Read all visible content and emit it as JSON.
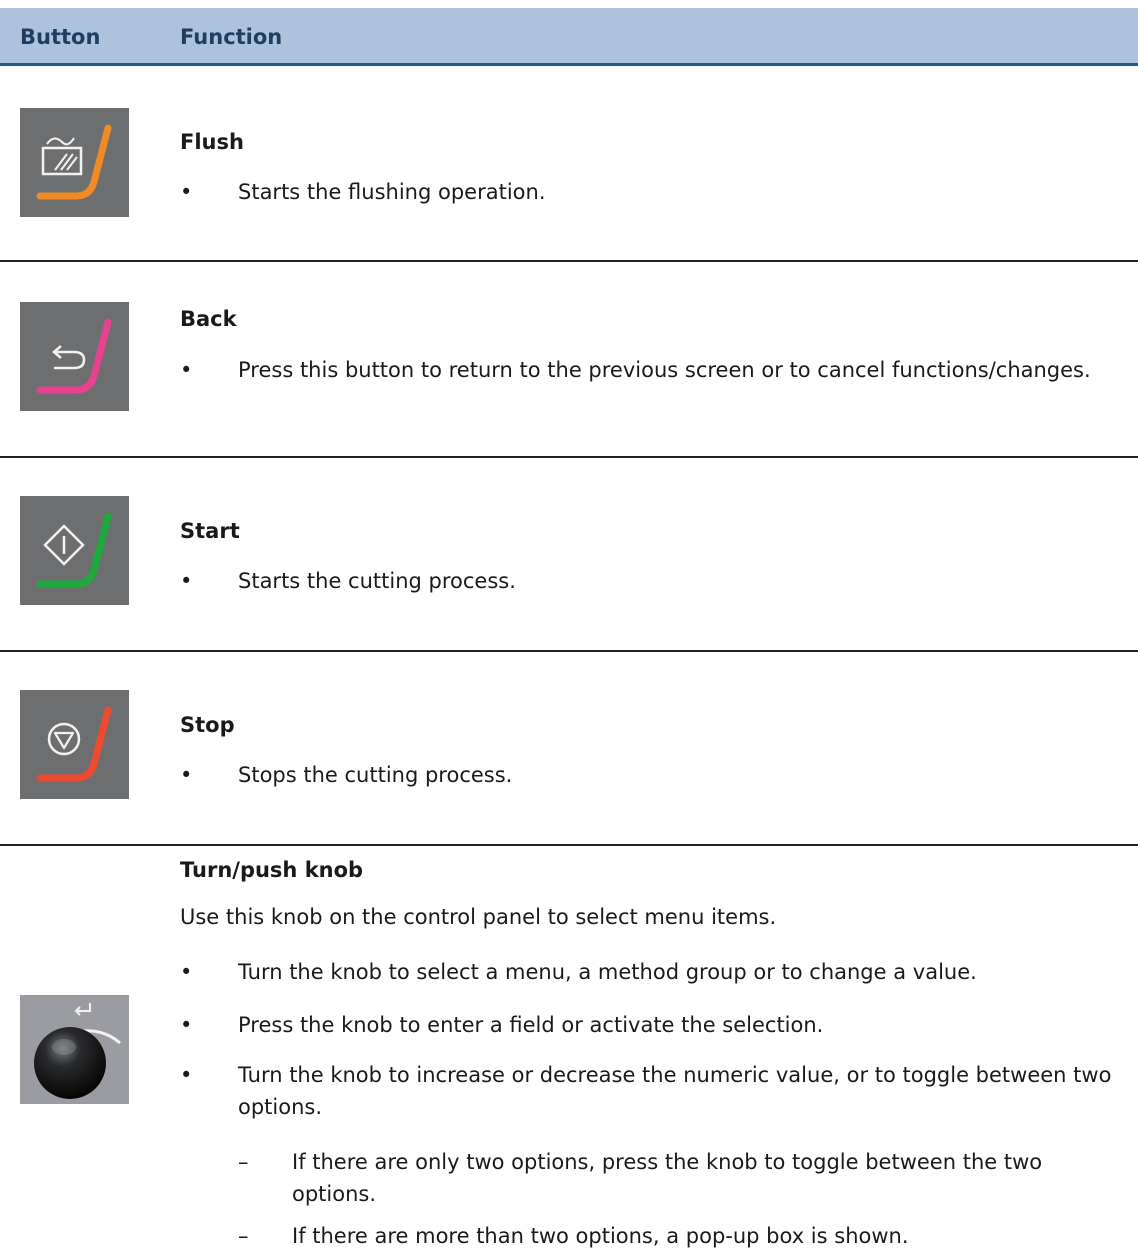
{
  "table_header": {
    "col_button": "Button",
    "col_function": "Function"
  },
  "rows": [
    {
      "icon": "flush-icon",
      "accent": "#f08a24",
      "title": "Flush",
      "bullets": [
        "Starts the flushing operation."
      ]
    },
    {
      "icon": "back-arrow-icon",
      "accent": "#e8418f",
      "title": "Back",
      "bullets": [
        "Press this button to return to the previous screen or to cancel functions/changes."
      ]
    },
    {
      "icon": "start-diamond-icon",
      "accent": "#1faa3c",
      "title": "Start",
      "bullets": [
        "Starts the cutting process."
      ]
    },
    {
      "icon": "stop-triangle-icon",
      "accent": "#ee4a30",
      "title": "Stop",
      "bullets": [
        "Stops the cutting process."
      ]
    }
  ],
  "knob": {
    "icon": "turn-push-knob-icon",
    "title": "Turn/push knob",
    "intro": "Use this knob on the control panel to select menu items.",
    "bullets": [
      "Turn the knob to select a menu, a method group or to change a value.",
      "Press the knob to enter a field or activate the selection.",
      "Turn the knob to increase or decrease the numeric value, or to toggle between two options."
    ],
    "bullet_symbol": "•",
    "dash_symbol": "–",
    "sub_items": [
      "If there are only two options, press the knob to toggle between the two options.",
      "If there are more than two options, a pop-up box is shown."
    ]
  }
}
